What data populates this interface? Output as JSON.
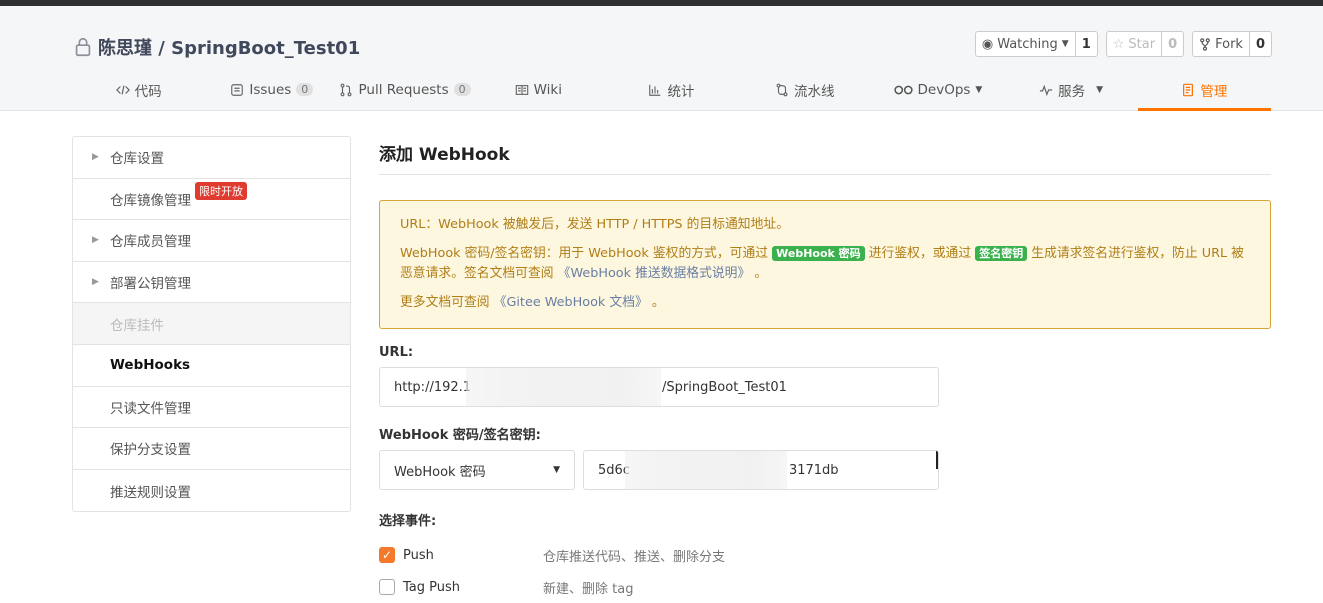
{
  "repo": {
    "title": "陈思瑾 / SpringBoot_Test01"
  },
  "actions": {
    "watch": {
      "label": "Watching",
      "count": "1"
    },
    "star": {
      "label": "Star",
      "count": "0"
    },
    "fork": {
      "label": "Fork",
      "count": "0"
    }
  },
  "tabs": [
    {
      "label": "代码",
      "icon": "code-icon"
    },
    {
      "label": "Issues",
      "badge": "0",
      "icon": "issues-icon"
    },
    {
      "label": "Pull Requests",
      "badge": "0",
      "icon": "pull-request-icon"
    },
    {
      "label": "Wiki",
      "icon": "wiki-icon"
    },
    {
      "label": "统计",
      "icon": "stats-icon"
    },
    {
      "label": "流水线",
      "icon": "pipeline-icon"
    },
    {
      "label": "DevOps",
      "icon": "devops-icon"
    },
    {
      "label": "服务",
      "icon": "service-icon"
    },
    {
      "label": "管理",
      "icon": "manage-icon",
      "active": true
    }
  ],
  "sidebar": {
    "items": [
      {
        "label": "仓库设置"
      },
      {
        "label": "仓库镜像管理",
        "tag": "限时开放"
      },
      {
        "label": "仓库成员管理"
      },
      {
        "label": "部署公钥管理"
      },
      {
        "label": "仓库挂件"
      },
      {
        "label": "WebHooks"
      },
      {
        "label": "只读文件管理"
      },
      {
        "label": "保护分支设置"
      },
      {
        "label": "推送规则设置"
      }
    ]
  },
  "main": {
    "title": "添加 WebHook",
    "tip": {
      "line1": "URL：WebHook 被触发后，发送 HTTP / HTTPS 的目标通知地址。",
      "line2_a": "WebHook 密码/签名密钥：用于 WebHook 鉴权的方式，可通过",
      "pill1": "WebHook 密码",
      "line2_b": "进行鉴权，或通过",
      "pill2": "签名密钥",
      "line2_c": "生成请求签名进行鉴权，防止 URL 被恶意请求。签名文档可查阅",
      "link1": "《WebHook 推送数据格式说明》",
      "line2_d": "。",
      "line3_a": "更多文档可查阅",
      "link2": "《Gitee WebHook 文档》",
      "line3_b": "。"
    },
    "url_label": "URL:",
    "url_prefix": "http://192.1",
    "url_suffix": "/SpringBoot_Test01",
    "secret_label": "WebHook 密码/签名密钥:",
    "secret_type": "WebHook 密码",
    "secret_prefix": "5d6c",
    "secret_suffix": "3171db",
    "events_label": "选择事件:",
    "events": [
      {
        "name": "Push",
        "desc": "仓库推送代码、推送、删除分支",
        "checked": true
      },
      {
        "name": "Tag Push",
        "desc": "新建、删除 tag",
        "checked": false
      }
    ]
  }
}
